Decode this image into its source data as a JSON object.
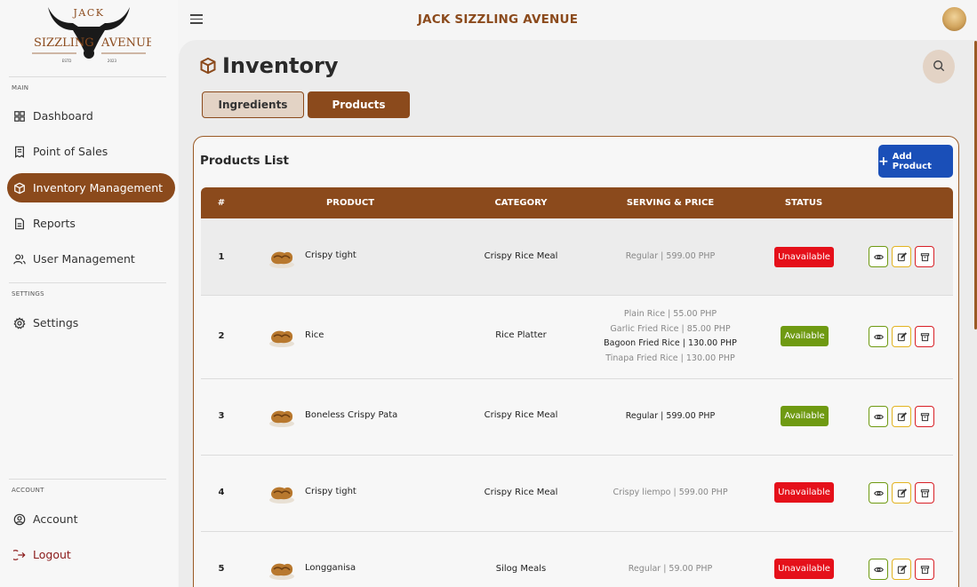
{
  "app": {
    "brand": "JACK SIZZLING AVENUE",
    "logo": {
      "top": "JACK",
      "left": "SIZZLING",
      "right": "AVENUE",
      "estd": "ESTD",
      "year": "2023"
    }
  },
  "sidebar": {
    "main_label": "MAIN",
    "settings_label": "SETTINGS",
    "account_label": "ACCOUNT",
    "items": [
      {
        "label": "Dashboard",
        "icon": "dashboard-icon"
      },
      {
        "label": "Point of Sales",
        "icon": "receipt-icon"
      },
      {
        "label": "Inventory Management",
        "icon": "box-icon",
        "active": true
      },
      {
        "label": "Reports",
        "icon": "document-icon"
      },
      {
        "label": "User Management",
        "icon": "users-icon"
      },
      {
        "label": "Settings",
        "icon": "gear-icon"
      },
      {
        "label": "Account",
        "icon": "account-icon"
      },
      {
        "label": "Logout",
        "icon": "logout-icon"
      }
    ]
  },
  "page": {
    "title": "Inventory",
    "tabs": [
      "Ingredients",
      "Products"
    ],
    "active_tab": "Products"
  },
  "products": {
    "title": "Products List",
    "add_button": "Add Product",
    "columns": [
      "#",
      "PRODUCT",
      "CATEGORY",
      "SERVING & PRICE",
      "STATUS"
    ],
    "rows": [
      {
        "num": "1",
        "name": "Crispy tight",
        "category": "Crispy Rice Meal",
        "servings": [
          {
            "text": "Regular | 599.00 PHP",
            "active": false
          }
        ],
        "status": "Unavailable"
      },
      {
        "num": "2",
        "name": "Rice",
        "category": "Rice Platter",
        "servings": [
          {
            "text": "Plain Rice | 55.00 PHP",
            "active": false
          },
          {
            "text": "Garlic Fried Rice | 85.00 PHP",
            "active": false
          },
          {
            "text": "Bagoon Fried Rice | 130.00 PHP",
            "active": true
          },
          {
            "text": "Tinapa Fried Rice | 130.00 PHP",
            "active": false
          }
        ],
        "status": "Available"
      },
      {
        "num": "3",
        "name": "Boneless Crispy Pata",
        "category": "Crispy Rice Meal",
        "servings": [
          {
            "text": "Regular | 599.00 PHP",
            "active": true
          }
        ],
        "status": "Available"
      },
      {
        "num": "4",
        "name": "Crispy tight",
        "category": "Crispy Rice Meal",
        "servings": [
          {
            "text": "Crispy liempo | 599.00 PHP",
            "active": false
          }
        ],
        "status": "Unavailable"
      },
      {
        "num": "5",
        "name": "Longganisa",
        "category": "Silog Meals",
        "servings": [
          {
            "text": "Regular | 59.00 PHP",
            "active": false
          }
        ],
        "status": "Unavailable"
      }
    ]
  },
  "colors": {
    "accent": "#8b4a1c",
    "primary_button": "#1a4fb8",
    "available": "#6f9a12",
    "unavailable": "#e5101a"
  }
}
